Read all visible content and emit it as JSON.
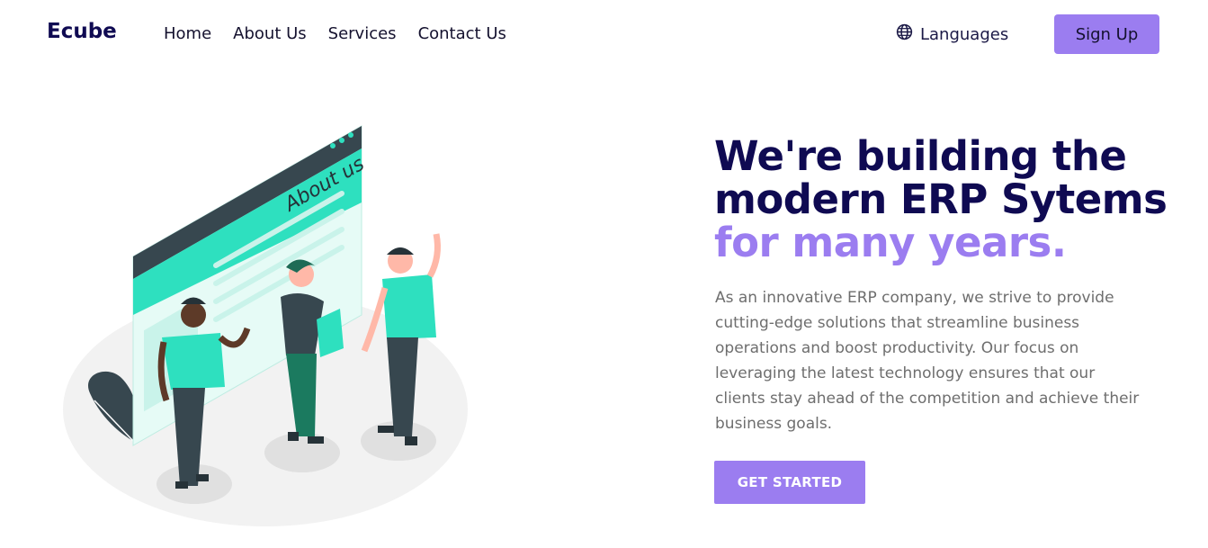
{
  "header": {
    "brand": "Ecube",
    "nav": [
      {
        "label": "Home"
      },
      {
        "label": "About Us"
      },
      {
        "label": "Services"
      },
      {
        "label": "Contact Us"
      }
    ],
    "languages_label": "Languages",
    "signup_label": "Sign Up"
  },
  "hero": {
    "headline_line1": "We're building the",
    "headline_line2": "modern ERP Sytems",
    "headline_accent": "for many years.",
    "description": "As an innovative ERP company, we strive to provide cutting-edge solutions that streamline business operations and boost productivity. Our focus on leveraging the latest technology ensures that our clients stay ahead of the competition and achieve their business goals.",
    "cta_label": "GET STARTED",
    "illustration_text": "About us"
  },
  "colors": {
    "brand_dark": "#0f0a52",
    "accent_purple": "#9b7df0",
    "teal": "#2ee0bf"
  },
  "icons": {
    "languages": "globe-icon"
  }
}
